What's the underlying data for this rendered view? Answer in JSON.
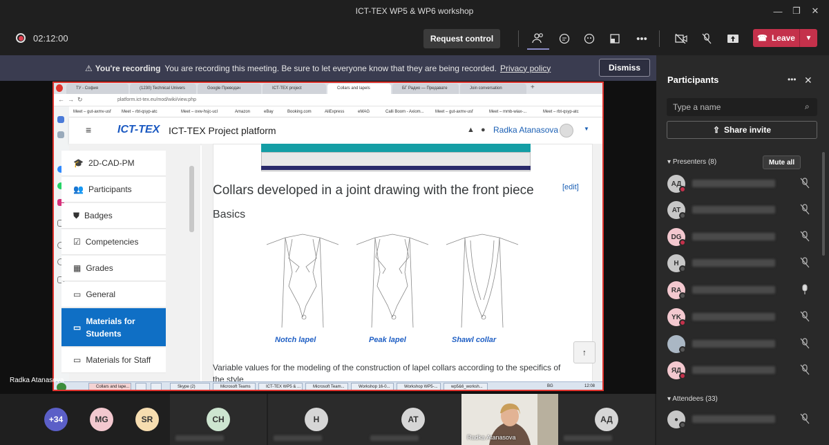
{
  "window": {
    "title": "ICT-TEX WP5 & WP6 workshop"
  },
  "meeting": {
    "timer": "02:12:00",
    "request_control": "Request control",
    "leave_label": "Leave"
  },
  "banner": {
    "heading": "You're recording",
    "message": "You are recording this meeting. Be sure to let everyone know that they are being recorded.",
    "link": "Privacy policy",
    "dismiss": "Dismiss"
  },
  "shared_screen": {
    "presenter_label": "Radka Atanasova",
    "browser_tabs": [
      "ТУ - София",
      "(1230) Technical Univers",
      "Google Преводач",
      "ICT-TEX project",
      "Collars and lapels",
      "БГ Радио — Предавате",
      "Join conversation"
    ],
    "url": "platform.ict-tex.eu/mod/wiki/view.php",
    "bookmarks": [
      "Meet – gut-axmv-usf",
      "Meet – rbt-qsyp-atc",
      "Meet – ovw-hsjc-ucl",
      "Amazon",
      "eBay",
      "Booking.com",
      "AliExpress",
      "eMAG",
      "Calli Boom - Axiom...",
      "Meet – gut-axmv-usf",
      "Meet – mmb-wiax-...",
      "Meet – rbt-qsyp-atc"
    ],
    "site_logo": "ICT-TEX",
    "site_name": "ICT-TEX Project platform",
    "user": "Radka Atanasova",
    "nav": [
      "2D-CAD-PM",
      "Participants",
      "Badges",
      "Competencies",
      "Grades",
      "General",
      "Materials for Students",
      "Materials for Staff"
    ],
    "nav_active": "Materials for Students",
    "heading": "Collars developed in a joint drawing with the front piece",
    "edit": "[edit]",
    "subheading": "Basics",
    "silhouettes": [
      "Notch lapel",
      "Peak lapel",
      "Shawl collar"
    ],
    "body_text": "Variable values for the modeling of the construction of lapel collars according to the specifics of the style",
    "taskbar_items": [
      "Collars and lape...",
      "",
      "",
      "Skype (2)",
      "Microsoft Teams",
      "ICT-TEX WP5 & ...",
      "Microsoft Team...",
      "Workshop 16-0...",
      "Workshop WP5-...",
      "wp5&6_worksh..."
    ],
    "taskbar_lang": "BG",
    "taskbar_time": "12:08"
  },
  "panel": {
    "title": "Participants",
    "search_placeholder": "Type a name",
    "share_invite": "Share invite",
    "presenters_label": "Presenters (8)",
    "mute_all": "Mute all",
    "attendees_label": "Attendees (33)",
    "presenters": [
      {
        "initials": "АД",
        "bg": "#c7c7c7",
        "mic": "off"
      },
      {
        "initials": "AT",
        "bg": "#c7c7c7",
        "mic": "off"
      },
      {
        "initials": "DG",
        "bg": "#f3c8cf",
        "mic": "off"
      },
      {
        "initials": "H",
        "bg": "#c7c7c7",
        "mic": "off"
      },
      {
        "initials": "RA",
        "bg": "#f3c8cf",
        "mic": "on"
      },
      {
        "initials": "YK",
        "bg": "#f3c8cf",
        "mic": "off"
      },
      {
        "initials": "",
        "bg": "#aab7c4",
        "mic": "off"
      },
      {
        "initials": "ЯД",
        "bg": "#f3c8cf",
        "mic": "off"
      }
    ]
  },
  "gallery": {
    "overflow": "+34",
    "avatars": [
      "MG",
      "SR",
      "CH",
      "H",
      "AT",
      "АД"
    ],
    "video_name": "Radka Atanasova"
  }
}
